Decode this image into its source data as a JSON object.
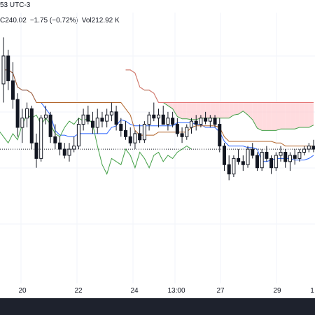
{
  "header": {
    "timezone": "53 UTC-3"
  },
  "legend": {
    "close": "C240.02",
    "change": "−1.75 (−0.72%)",
    "volume": "Vol212.92 K"
  },
  "colors": {
    "up": "#131722",
    "down": "#131722",
    "tenkan": "#2962ff",
    "kijun": "#b2652b",
    "chikou": "#43a047",
    "spanA": "#43a047",
    "spanB": "#e57373",
    "cloud_bull": "#c8e6c9",
    "cloud_bear": "#ffcdd2",
    "grid": "#f0f3fa"
  },
  "chart_data": {
    "type": "candlestick",
    "indicator": "Ichimoku Cloud",
    "x_tick_labels": [
      "20",
      "22",
      "24",
      "13:00",
      "27",
      "29",
      "1"
    ],
    "current_price_line": "dotted",
    "candles": [
      [
        257,
        272,
        251,
        266
      ],
      [
        266,
        268,
        255,
        258
      ],
      [
        258,
        264,
        249,
        252
      ],
      [
        252,
        254,
        240,
        243
      ],
      [
        243,
        249,
        238,
        246
      ],
      [
        246,
        251,
        243,
        249
      ],
      [
        249,
        250,
        236,
        238
      ],
      [
        238,
        241,
        230,
        233
      ],
      [
        233,
        247,
        232,
        246
      ],
      [
        246,
        250,
        244,
        247
      ],
      [
        247,
        248,
        238,
        240
      ],
      [
        240,
        244,
        236,
        238
      ],
      [
        238,
        240,
        234,
        236
      ],
      [
        236,
        238,
        233,
        234
      ],
      [
        234,
        238,
        232,
        236
      ],
      [
        236,
        240,
        235,
        237
      ],
      [
        237,
        246,
        236,
        244
      ],
      [
        244,
        249,
        242,
        247
      ],
      [
        247,
        250,
        244,
        245
      ],
      [
        245,
        248,
        241,
        243
      ],
      [
        243,
        249,
        241,
        246
      ],
      [
        246,
        248,
        243,
        245
      ],
      [
        245,
        249,
        243,
        247
      ],
      [
        247,
        251,
        245,
        248
      ],
      [
        248,
        250,
        242,
        244
      ],
      [
        244,
        246,
        240,
        242
      ],
      [
        242,
        245,
        239,
        240
      ],
      [
        240,
        243,
        237,
        238
      ],
      [
        238,
        242,
        236,
        241
      ],
      [
        241,
        244,
        238,
        239
      ],
      [
        239,
        245,
        238,
        244
      ],
      [
        244,
        248,
        242,
        247
      ],
      [
        247,
        251,
        245,
        246
      ],
      [
        246,
        249,
        243,
        247
      ],
      [
        247,
        250,
        244,
        244
      ],
      [
        244,
        248,
        242,
        246
      ],
      [
        246,
        248,
        243,
        244
      ],
      [
        244,
        246,
        240,
        241
      ],
      [
        241,
        243,
        238,
        240
      ],
      [
        240,
        244,
        239,
        243
      ],
      [
        243,
        246,
        241,
        245
      ],
      [
        245,
        247,
        242,
        244
      ],
      [
        244,
        247,
        243,
        246
      ],
      [
        246,
        248,
        244,
        245
      ],
      [
        245,
        247,
        243,
        246
      ],
      [
        246,
        247,
        243,
        244
      ],
      [
        244,
        246,
        235,
        237
      ],
      [
        237,
        238,
        229,
        231
      ],
      [
        231,
        234,
        226,
        228
      ],
      [
        228,
        234,
        227,
        233
      ],
      [
        233,
        236,
        231,
        232
      ],
      [
        232,
        234,
        229,
        231
      ],
      [
        231,
        237,
        230,
        236
      ],
      [
        236,
        238,
        233,
        234
      ],
      [
        234,
        235,
        229,
        230
      ],
      [
        230,
        236,
        229,
        235
      ],
      [
        235,
        237,
        232,
        233
      ],
      [
        233,
        234,
        228,
        230
      ],
      [
        230,
        235,
        229,
        234
      ],
      [
        234,
        237,
        232,
        235
      ],
      [
        235,
        236,
        230,
        232
      ],
      [
        232,
        235,
        229,
        234
      ],
      [
        234,
        236,
        231,
        233
      ],
      [
        233,
        236,
        232,
        235
      ],
      [
        235,
        237,
        234,
        236
      ],
      [
        236,
        238,
        235,
        237
      ],
      [
        237,
        239,
        235,
        236
      ]
    ]
  }
}
